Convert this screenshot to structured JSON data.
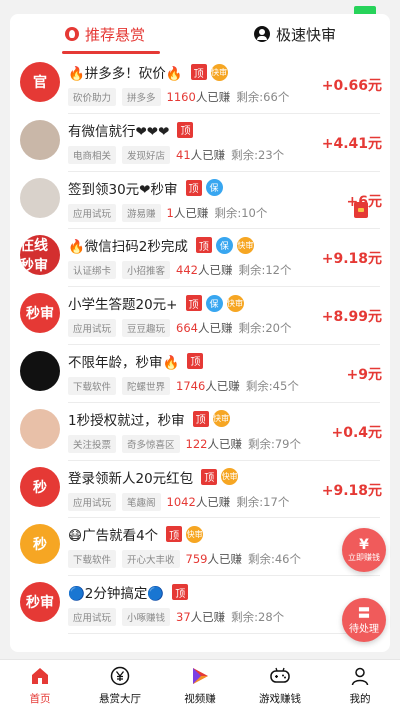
{
  "tabs": [
    {
      "label": "推荐悬赏",
      "active": true
    },
    {
      "label": "极速快审",
      "active": false
    }
  ],
  "badges": {
    "ding": "顶",
    "bao": "保",
    "kuai": "快审"
  },
  "tasks": [
    {
      "avatar": "官",
      "avatar_color": "#e53935",
      "title": "🔥拼多多！砍价🔥",
      "ding": true,
      "bao": false,
      "kuai": true,
      "tag1": "砍价助力",
      "tag2": "拼多多",
      "earned": "1160",
      "earned_suffix": "人已赚",
      "remain": "剩余:66个",
      "price": "+0.66元"
    },
    {
      "avatar": "",
      "avatar_color": "#c9b7a8",
      "title": "有微信就行❤❤❤",
      "ding": true,
      "bao": false,
      "kuai": false,
      "tag1": "电商相关",
      "tag2": "发现好店",
      "earned": "41",
      "earned_suffix": "人已赚",
      "remain": "剩余:23个",
      "price": "+4.41元"
    },
    {
      "avatar": "",
      "avatar_color": "#d9d2cb",
      "title": "签到领30元❤秒审",
      "ding": true,
      "bao": true,
      "kuai": false,
      "tag1": "应用试玩",
      "tag2": "游易赚",
      "earned": "1",
      "earned_suffix": "人已赚",
      "remain": "剩余:10个",
      "price": "+6元"
    },
    {
      "avatar": "在线秒审",
      "avatar_color": "#d32f2f",
      "title": "🔥微信扫码2秒完成",
      "ding": true,
      "bao": true,
      "kuai": true,
      "tag1": "认证绑卡",
      "tag2": "小招推客",
      "earned": "442",
      "earned_suffix": "人已赚",
      "remain": "剩余:12个",
      "price": "+9.18元"
    },
    {
      "avatar": "秒审",
      "avatar_color": "#e53935",
      "title": "小学生答题20元+",
      "ding": true,
      "bao": true,
      "kuai": true,
      "tag1": "应用试玩",
      "tag2": "豆豆趣玩",
      "earned": "664",
      "earned_suffix": "人已赚",
      "remain": "剩余:20个",
      "price": "+8.99元"
    },
    {
      "avatar": "",
      "avatar_color": "#111111",
      "title": "不限年龄，秒审🔥",
      "ding": true,
      "bao": false,
      "kuai": false,
      "tag1": "下载软件",
      "tag2": "陀螺世界",
      "earned": "1746",
      "earned_suffix": "人已赚",
      "remain": "剩余:45个",
      "price": "+9元"
    },
    {
      "avatar": "",
      "avatar_color": "#e8c0a8",
      "title": "1秒授权就过，秒审",
      "ding": true,
      "bao": false,
      "kuai": true,
      "tag1": "关注投票",
      "tag2": "奇多惊喜区",
      "earned": "122",
      "earned_suffix": "人已赚",
      "remain": "剩余:79个",
      "price": "+0.4元"
    },
    {
      "avatar": "秒",
      "avatar_color": "#e53935",
      "title": "登录领新人20元红包",
      "ding": true,
      "bao": false,
      "kuai": true,
      "tag1": "应用试玩",
      "tag2": "笔趣阁",
      "earned": "1042",
      "earned_suffix": "人已赚",
      "remain": "剩余:17个",
      "price": "+9.18元"
    },
    {
      "avatar": "秒",
      "avatar_color": "#f6a623",
      "title": "😷广告就看4个",
      "ding": true,
      "bao": false,
      "kuai": true,
      "tag1": "下载软件",
      "tag2": "开心大丰收",
      "earned": "759",
      "earned_suffix": "人已赚",
      "remain": "剩余:46个",
      "price": ""
    },
    {
      "avatar": "秒审",
      "avatar_color": "#e53935",
      "title": "🔵2分钟搞定🔵",
      "ding": true,
      "bao": false,
      "kuai": false,
      "tag1": "应用试玩",
      "tag2": "小啄赚钱",
      "earned": "37",
      "earned_suffix": "人已赚",
      "remain": "剩余:28个",
      "price": ""
    }
  ],
  "float_buttons": {
    "earn": {
      "glyph": "¥",
      "label": "立即赚钱"
    },
    "pending": {
      "glyph": "〓",
      "label": "待处理"
    }
  },
  "tabbar": [
    {
      "label": "首页",
      "icon": "home-icon",
      "active": true
    },
    {
      "label": "悬赏大厅",
      "icon": "yuan-icon",
      "active": false
    },
    {
      "label": "视频赚",
      "icon": "video-icon",
      "active": false
    },
    {
      "label": "游戏赚钱",
      "icon": "gamepad-icon",
      "active": false
    },
    {
      "label": "我的",
      "icon": "profile-icon",
      "active": false
    }
  ],
  "colors": {
    "accent": "#e53935",
    "status_green": "#27d35a"
  }
}
